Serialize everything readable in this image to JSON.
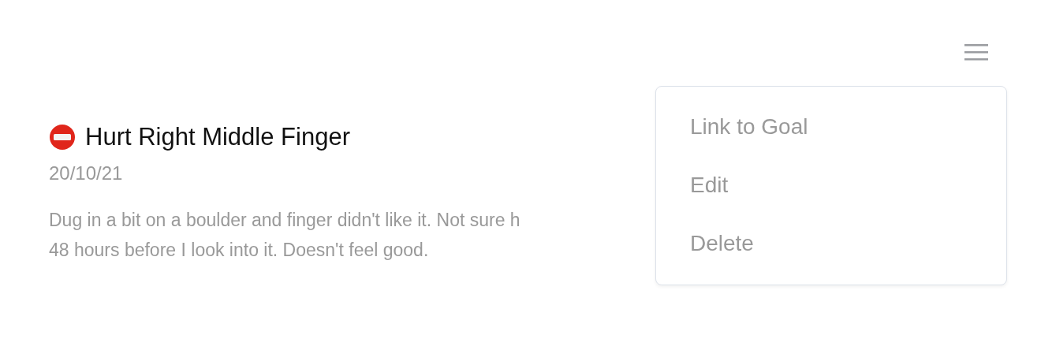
{
  "entry": {
    "title": "Hurt Right Middle Finger",
    "date": "20/10/21",
    "description": "Dug in a bit on a boulder and finger didn't like it. Not sure h\n48 hours before I look into it. Doesn't feel good."
  },
  "menu": {
    "expanded": true,
    "items": [
      {
        "label": "Link to Goal"
      },
      {
        "label": "Edit"
      },
      {
        "label": "Delete"
      }
    ]
  }
}
